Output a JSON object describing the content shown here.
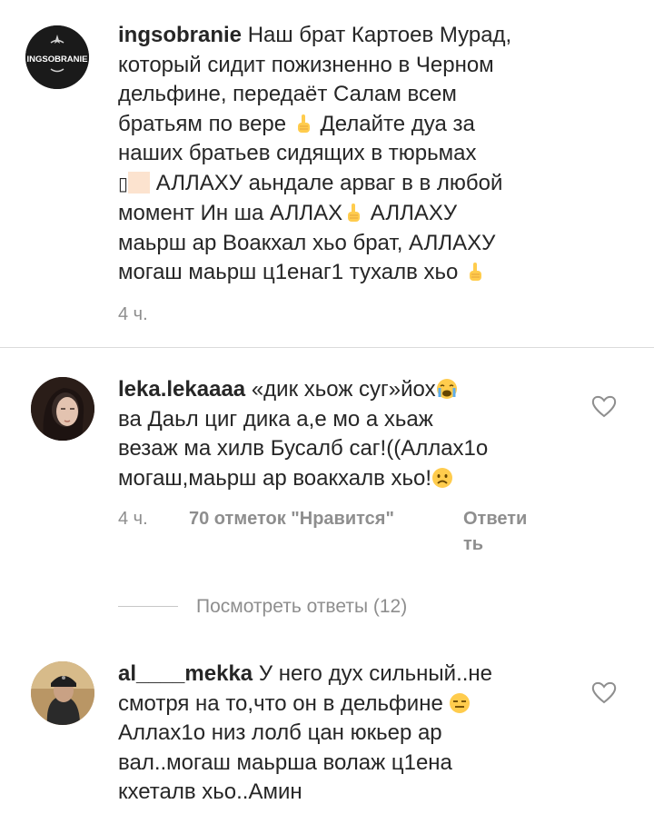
{
  "comments": [
    {
      "username": "ingsobranie",
      "avatar_text": "INGSOBRANIE",
      "lines": [
        "Наш брат Картоев Мурад,",
        "который сидит пожизненно в Черном",
        "дельфине, передаёт Салам всем",
        "братьям по вере",
        "Делайте дуа за",
        "наших братьев сидящих в тюрьмах",
        "АЛЛАХУ аьндале арваг в в любой",
        "момент Ин ша АЛЛАХ",
        "АЛЛАХУ",
        "маьрш ар Воакхал хьо брат, АЛЛАХУ",
        "могаш маьрш ц1енаг1 тухалв хьо"
      ],
      "time": "4 ч."
    },
    {
      "username": "leka.lekaaaa",
      "lines": [
        "«дик хьож суг»йох",
        "ва Даьл циг дика а,е мо а хьаж",
        "везаж ма хилв Бусалб саг!((Аллах1о",
        "могаш,маьрш ар воакхалв хьо!"
      ],
      "time": "4 ч.",
      "likes": "70 отметок \"Нравится\"",
      "reply_1": "Ответи",
      "reply_2": "ть",
      "view_replies": "Посмотреть ответы (12)"
    },
    {
      "username": "al____mekka",
      "lines": [
        "У него дух сильный..не",
        "смотря на то,что он в дельфине",
        "Аллах1о низ лолб цан юкьер ар",
        "вал..могаш маьрша волаж ц1ена",
        "кхеталв хьо..Амин"
      ]
    }
  ],
  "icons": {
    "heart": "heart-outline-icon",
    "pointing_up": "index-pointing-up-emoji",
    "crying_face": "loudly-crying-face-emoji",
    "frowning_face": "frowning-face-emoji",
    "expressionless_face": "expressionless-face-emoji"
  },
  "colors": {
    "text": "#262626",
    "secondary": "#8e8e8e",
    "divider": "#dbdbdb",
    "avatar_dark": "#1a1a1a"
  }
}
